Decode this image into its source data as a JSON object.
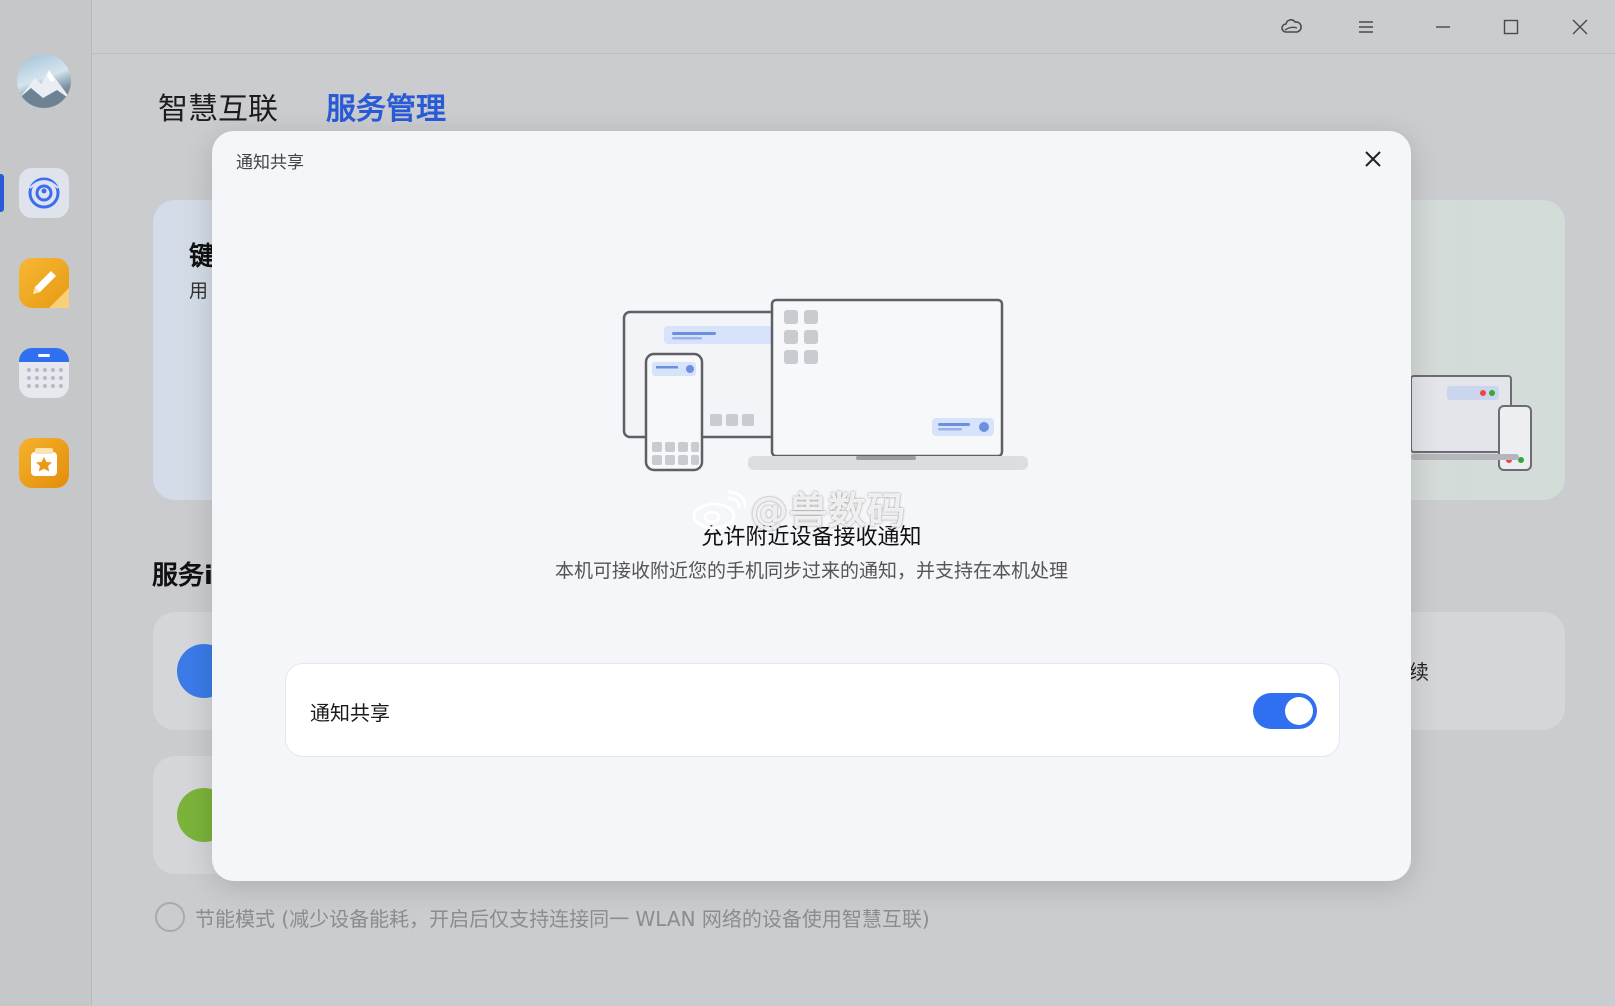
{
  "titlebar": {
    "icons": [
      "cloud-icon",
      "menu-icon",
      "minimize-icon",
      "maximize-icon",
      "close-icon"
    ]
  },
  "tabs": [
    {
      "label": "智慧互联",
      "active": false
    },
    {
      "label": "服务管理",
      "active": true
    }
  ],
  "background": {
    "card_title_fragment": "键",
    "card_sub_fragment": "用",
    "section_title_fragment": "服务i",
    "right_text_fragment": "续"
  },
  "modal": {
    "title": "通知共享",
    "heading": "允许附近设备接收通知",
    "description": "本机可接收附近您的手机同步过来的通知，并支持在本机处理",
    "setting_label": "通知共享",
    "toggle_on": true
  },
  "watermark": "@兽数码",
  "footer": {
    "power_saving_label": "节能模式 (减少设备能耗，开启后仅支持连接同一 WLAN 网络的设备使用智慧互联)"
  },
  "colors": {
    "accent": "#2f6ff0",
    "active_tab": "#2a5bd7"
  }
}
